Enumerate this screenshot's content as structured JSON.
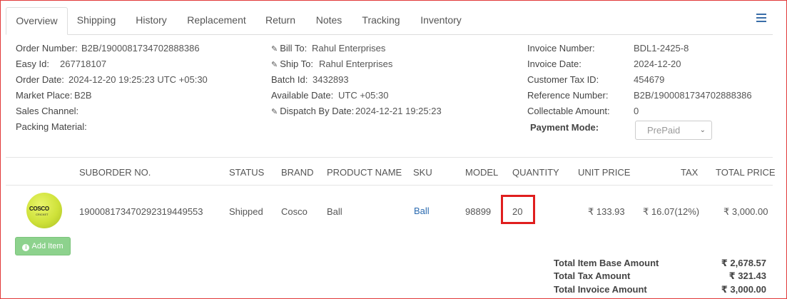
{
  "tabs": [
    {
      "label": "Overview"
    },
    {
      "label": "Shipping"
    },
    {
      "label": "History"
    },
    {
      "label": "Replacement"
    },
    {
      "label": "Return"
    },
    {
      "label": "Notes"
    },
    {
      "label": "Tracking"
    },
    {
      "label": "Inventory"
    }
  ],
  "left_info": {
    "order_number_label": "Order Number:",
    "order_number": "B2B/1900081734702888386",
    "easy_id_label": "Easy Id:",
    "easy_id": "267718107",
    "order_date_label": "Order Date:",
    "order_date": "2024-12-20 19:25:23 UTC +05:30",
    "market_place_label": "Market Place:",
    "market_place": "B2B",
    "sales_channel_label": "Sales Channel:",
    "packing_material_label": "Packing Material:"
  },
  "mid_info": {
    "bill_to_label": "Bill To:",
    "bill_to": "Rahul Enterprises",
    "ship_to_label": "Ship To:",
    "ship_to": "Rahul Enterprises",
    "batch_id_label": "Batch Id:",
    "batch_id": "3432893",
    "available_date_label": "Available Date:",
    "available_date": "UTC +05:30",
    "dispatch_by_label": "Dispatch By Date:",
    "dispatch_by": "2024-12-21 19:25:23"
  },
  "right_info": {
    "invoice_number_label": "Invoice Number:",
    "invoice_number": "BDL1-2425-8",
    "invoice_date_label": "Invoice Date:",
    "invoice_date": "2024-12-20",
    "customer_tax_label": "Customer Tax ID:",
    "customer_tax": "454679",
    "reference_label": "Reference Number:",
    "reference": "B2B/1900081734702888386",
    "collectable_label": "Collectable Amount:",
    "collectable": "0",
    "payment_mode_label": "Payment Mode:",
    "payment_mode": "PrePaid"
  },
  "table": {
    "headers": [
      "SUBORDER NO.",
      "STATUS",
      "BRAND",
      "PRODUCT NAME",
      "SKU",
      "MODEL",
      "QUANTITY",
      "UNIT PRICE",
      "TAX",
      "TOTAL PRICE"
    ],
    "row": {
      "image_logo": "COSCO",
      "image_sub": "CRICKET",
      "suborder": "1900081734702923194495​53",
      "status": "Shipped",
      "brand": "Cosco",
      "product": "Ball",
      "sku": "Ball",
      "model": "98899",
      "quantity": "20",
      "unit_price": "₹ 133.93",
      "tax": "₹ 16.07(12%)",
      "total": "₹ 3,000.00"
    }
  },
  "add_item_label": "Add Item",
  "totals": {
    "base_label": "Total Item Base Amount",
    "base": "₹ 2,678.57",
    "tax_label": "Total Tax Amount",
    "tax": "₹ 321.43",
    "invoice_label": "Total Invoice Amount",
    "invoice": "₹ 3,000.00"
  }
}
